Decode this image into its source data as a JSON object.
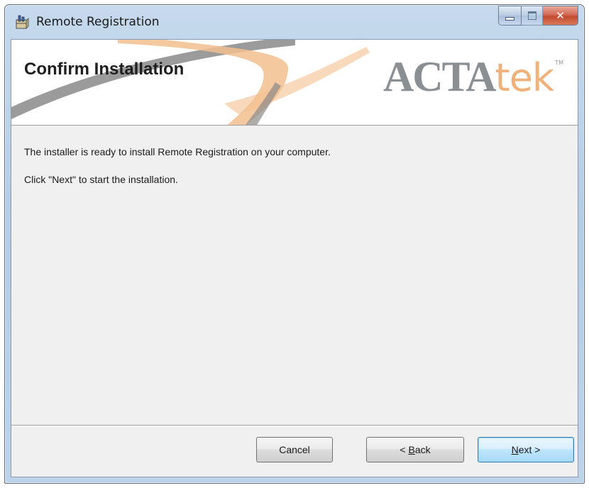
{
  "window": {
    "title": "Remote Registration",
    "icon": "installer-package-icon",
    "controls": {
      "minimize": "minimize-icon",
      "maximize": "maximize-icon",
      "close": "close-icon"
    }
  },
  "banner": {
    "title": "Confirm Installation",
    "logo": {
      "bold_text": "ACTA",
      "light_text": "tek",
      "trademark": "TM"
    }
  },
  "body": {
    "line1": "The installer is ready to install Remote Registration on your computer.",
    "line2": "Click \"Next\" to start the installation."
  },
  "buttons": {
    "cancel": "Cancel",
    "back_prefix": "< ",
    "back_mnemonic": "B",
    "back_rest": "ack",
    "next_mnemonic": "N",
    "next_rest": "ext >"
  },
  "colors": {
    "logo_grey": "#8a8f93",
    "logo_orange": "#f0b27a",
    "swoosh_grey": "#8a8a8a",
    "swoosh_orange": "#f3c08f",
    "close_red": "#c24a2f"
  }
}
